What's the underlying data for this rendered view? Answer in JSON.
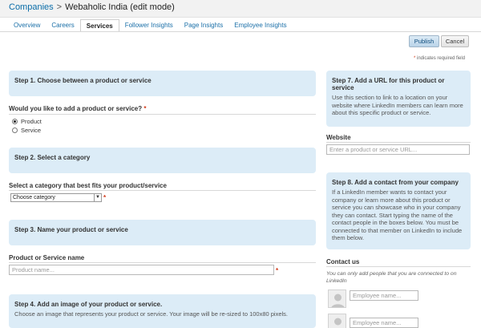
{
  "breadcrumb": {
    "root": "Companies",
    "separator": ">",
    "current": "Webaholic India (edit mode)"
  },
  "tabs": [
    "Overview",
    "Careers",
    "Services",
    "Follower Insights",
    "Page Insights",
    "Employee Insights"
  ],
  "active_tab": "Services",
  "actions": {
    "publish": "Publish",
    "cancel": "Cancel"
  },
  "required_note": {
    "star": "*",
    "text": "indicates required field"
  },
  "step1": {
    "title": "Step 1. Choose between a product or service",
    "question": "Would you like to add a product or service?",
    "star": "*",
    "options": [
      "Product",
      "Service"
    ],
    "selected": "Product"
  },
  "step2": {
    "title": "Step 2. Select a category",
    "label": "Select a category that best fits your product/service",
    "select_value": "Choose category",
    "star": "*"
  },
  "step3": {
    "title": "Step 3. Name your product or service",
    "label": "Product or Service name",
    "placeholder": "Product name...",
    "star": "*"
  },
  "step4": {
    "title": "Step 4. Add an image of your product or service.",
    "desc": "Choose an image that represents your product or service. Your image will be re-sized to 100x80 pixels."
  },
  "step7": {
    "title": "Step 7. Add a URL for this product or service",
    "desc": "Use this section to link to a location on your website where LinkedIn members can learn more about this specific product or service.",
    "field_label": "Website",
    "placeholder": "Enter a product or service URL..."
  },
  "step8": {
    "title": "Step 8. Add a contact from your company",
    "desc": "If a LinkedIn member wants to contact your company or learn more about this product or service you can showcase who in your company they can contact. Start typing the name of the contact people in the boxes below. You must be connected to that member on LinkedIn to include them below.",
    "contact_label": "Contact us",
    "contact_note": "You can only add people that you are connected to on LinkedIn",
    "employee_placeholder": "Employee name..."
  }
}
